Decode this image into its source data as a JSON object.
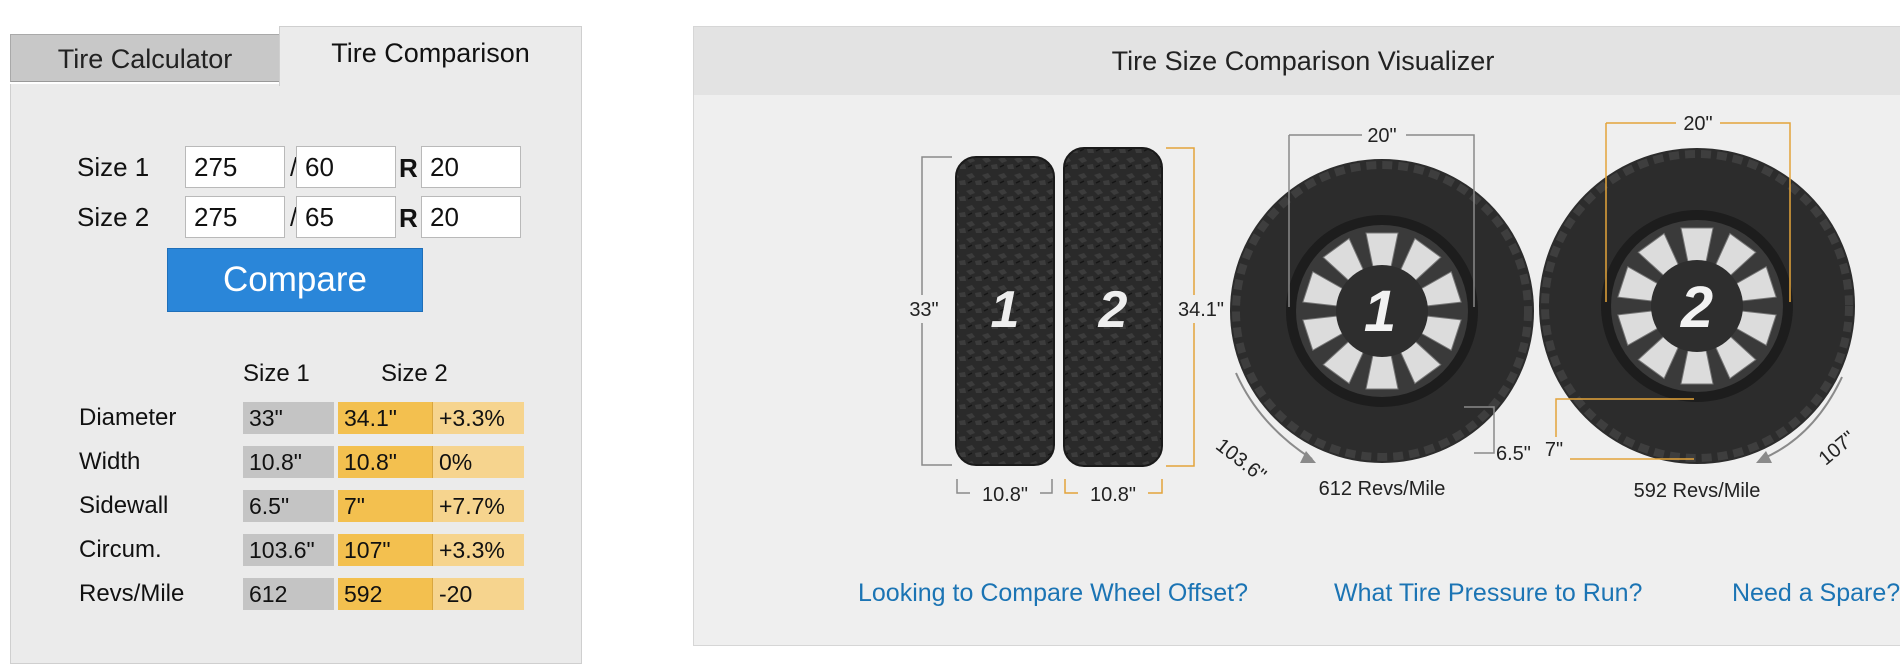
{
  "tabs": {
    "calculator": "Tire Calculator",
    "comparison": "Tire Comparison"
  },
  "sizes": {
    "size1": {
      "label": "Size 1",
      "width": "275",
      "aspect": "60",
      "rim": "20"
    },
    "size2": {
      "label": "Size 2",
      "width": "275",
      "aspect": "65",
      "rim": "20"
    },
    "slash": "/",
    "r": "R"
  },
  "compare_button": "Compare",
  "results": {
    "col1": "Size 1",
    "col2": "Size 2",
    "rows": [
      {
        "label": "Diameter",
        "size1": "33\"",
        "size2": "34.1\"",
        "diff": "+3.3%"
      },
      {
        "label": "Width",
        "size1": "10.8\"",
        "size2": "10.8\"",
        "diff": "0%"
      },
      {
        "label": "Sidewall",
        "size1": "6.5\"",
        "size2": "7\"",
        "diff": "+7.7%"
      },
      {
        "label": "Circum.",
        "size1": "103.6\"",
        "size2": "107\"",
        "diff": "+3.3%"
      },
      {
        "label": "Revs/Mile",
        "size1": "612",
        "size2": "592",
        "diff": "-20"
      }
    ]
  },
  "visualizer": {
    "title": "Tire Size Comparison Visualizer",
    "tire1": {
      "number": "1",
      "diameter": "33\"",
      "width": "10.8\"",
      "rim": "20\"",
      "sidewall": "6.5\"",
      "circumference": "103.6\"",
      "revs": "612 Revs/Mile"
    },
    "tire2": {
      "number": "2",
      "diameter": "34.1\"",
      "width": "10.8\"",
      "rim": "20\"",
      "sidewall": "7\"",
      "circumference": "107\"",
      "revs": "592 Revs/Mile"
    },
    "colors": {
      "tire1_lines": "#8a8a8a",
      "tire2_lines": "#e3a43a",
      "tire": "#2b2b2b"
    }
  },
  "links": {
    "offset": "Looking to Compare Wheel Offset?",
    "pressure": "What Tire Pressure to Run?",
    "spare": "Need a Spare?"
  }
}
